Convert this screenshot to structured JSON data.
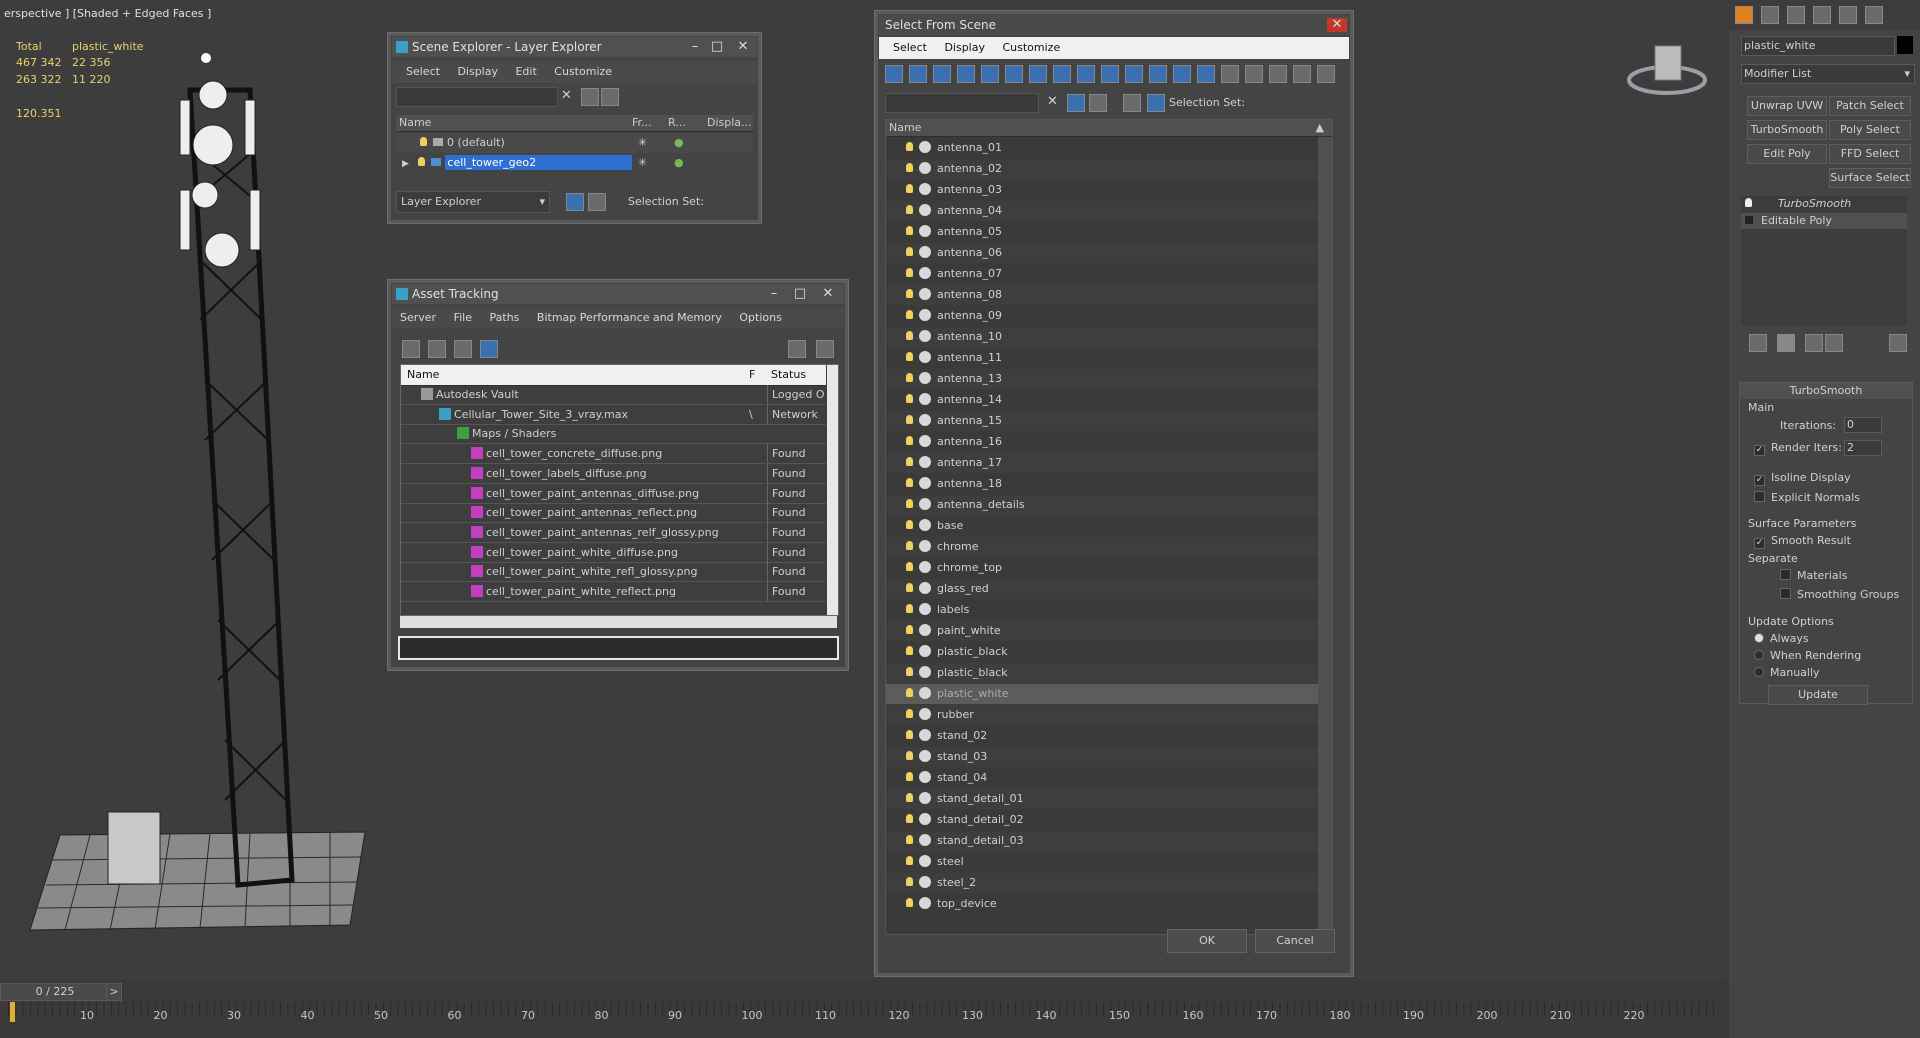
{
  "viewport": {
    "label": "erspective ] [Shaded + Edged Faces ]",
    "stats": {
      "col_total": "Total",
      "col_selected": "plastic_white",
      "row1_total": "467 342",
      "row1_selected": "22 356",
      "row2_total": "263 322",
      "row2_selected": "11 220",
      "fps": "120.351"
    }
  },
  "scene_explorer": {
    "title": "Scene Explorer - Layer Explorer",
    "menu": [
      "Select",
      "Display",
      "Edit",
      "Customize"
    ],
    "columns": [
      "Name",
      "Fr...",
      "R...",
      "Displa..."
    ],
    "rows": [
      {
        "name": "0 (default)",
        "selected": false
      },
      {
        "name": "cell_tower_geo2",
        "selected": true
      }
    ],
    "footer_dropdown": "Layer Explorer",
    "selection_set_label": "Selection Set:"
  },
  "asset_tracking": {
    "title": "Asset Tracking",
    "menu": [
      "Server",
      "File",
      "Paths",
      "Bitmap Performance and Memory",
      "Options"
    ],
    "columns": [
      "Name",
      "F",
      "Status"
    ],
    "rows": [
      {
        "name": "Autodesk Vault",
        "flag": "",
        "status": "Logged O",
        "indent": 1,
        "icon": "vault"
      },
      {
        "name": "Cellular_Tower_Site_3_vray.max",
        "flag": "\\",
        "status": "Network",
        "indent": 2,
        "icon": "max"
      },
      {
        "name": "Maps / Shaders",
        "flag": "",
        "status": "",
        "indent": 3,
        "icon": "maps"
      },
      {
        "name": "cell_tower_concrete_diffuse.png",
        "flag": "",
        "status": "Found",
        "indent": 4,
        "icon": "png"
      },
      {
        "name": "cell_tower_labels_diffuse.png",
        "flag": "",
        "status": "Found",
        "indent": 4,
        "icon": "png"
      },
      {
        "name": "cell_tower_paint_antennas_diffuse.png",
        "flag": "",
        "status": "Found",
        "indent": 4,
        "icon": "png"
      },
      {
        "name": "cell_tower_paint_antennas_reflect.png",
        "flag": "",
        "status": "Found",
        "indent": 4,
        "icon": "png"
      },
      {
        "name": "cell_tower_paint_antennas_relf_glossy.png",
        "flag": "",
        "status": "Found",
        "indent": 4,
        "icon": "png"
      },
      {
        "name": "cell_tower_paint_white_diffuse.png",
        "flag": "",
        "status": "Found",
        "indent": 4,
        "icon": "png"
      },
      {
        "name": "cell_tower_paint_white_refl_glossy.png",
        "flag": "",
        "status": "Found",
        "indent": 4,
        "icon": "png"
      },
      {
        "name": "cell_tower_paint_white_reflect.png",
        "flag": "",
        "status": "Found",
        "indent": 4,
        "icon": "png"
      }
    ]
  },
  "select_from_scene": {
    "title": "Select From Scene",
    "menu": [
      "Select",
      "Display",
      "Customize"
    ],
    "selection_set_label": "Selection Set:",
    "column": "Name",
    "items": [
      "antenna_01",
      "antenna_02",
      "antenna_03",
      "antenna_04",
      "antenna_05",
      "antenna_06",
      "antenna_07",
      "antenna_08",
      "antenna_09",
      "antenna_10",
      "antenna_11",
      "antenna_13",
      "antenna_14",
      "antenna_15",
      "antenna_16",
      "antenna_17",
      "antenna_18",
      "antenna_details",
      "base",
      "chrome",
      "chrome_top",
      "glass_red",
      "labels",
      "paint_white",
      "plastic_black",
      "plastic_black",
      "plastic_white",
      "rubber",
      "stand_02",
      "stand_03",
      "stand_04",
      "stand_detail_01",
      "stand_detail_02",
      "stand_detail_03",
      "steel",
      "steel_2",
      "top_device"
    ],
    "selected_item": "plastic_white",
    "ok_label": "OK",
    "cancel_label": "Cancel"
  },
  "command_panel": {
    "object_name": "plastic_white",
    "modifier_list": "Modifier List",
    "modifier_buttons": [
      "Unwrap UVW",
      "Patch Select",
      "TurboSmooth",
      "Poly Select",
      "Edit Poly",
      "FFD Select",
      "Surface Select"
    ],
    "stack": [
      "TurboSmooth",
      "Editable Poly"
    ],
    "rollout_title": "TurboSmooth",
    "main_label": "Main",
    "iterations_label": "Iterations:",
    "iterations_value": "0",
    "render_iters_label": "Render Iters:",
    "render_iters_value": "2",
    "isoline_label": "Isoline Display",
    "explicit_normals_label": "Explicit Normals",
    "surface_params_label": "Surface Parameters",
    "smooth_result_label": "Smooth Result",
    "separate_label": "Separate",
    "materials_label": "Materials",
    "smoothing_groups_label": "Smoothing Groups",
    "update_options_label": "Update Options",
    "always_label": "Always",
    "when_rendering_label": "When Rendering",
    "manually_label": "Manually",
    "update_button": "Update"
  },
  "timeline": {
    "frame_counter": "0 / 225",
    "next_label": ">",
    "ticks": [
      "10",
      "20",
      "30",
      "40",
      "50",
      "60",
      "70",
      "80",
      "90",
      "100",
      "110",
      "120",
      "130",
      "140",
      "150",
      "160",
      "170",
      "180",
      "190",
      "200",
      "210",
      "220"
    ]
  },
  "colors": {
    "selection_blue": "#2f6fd0",
    "stats_yellow": "#e8d36a",
    "panel_gray": "#444444"
  }
}
